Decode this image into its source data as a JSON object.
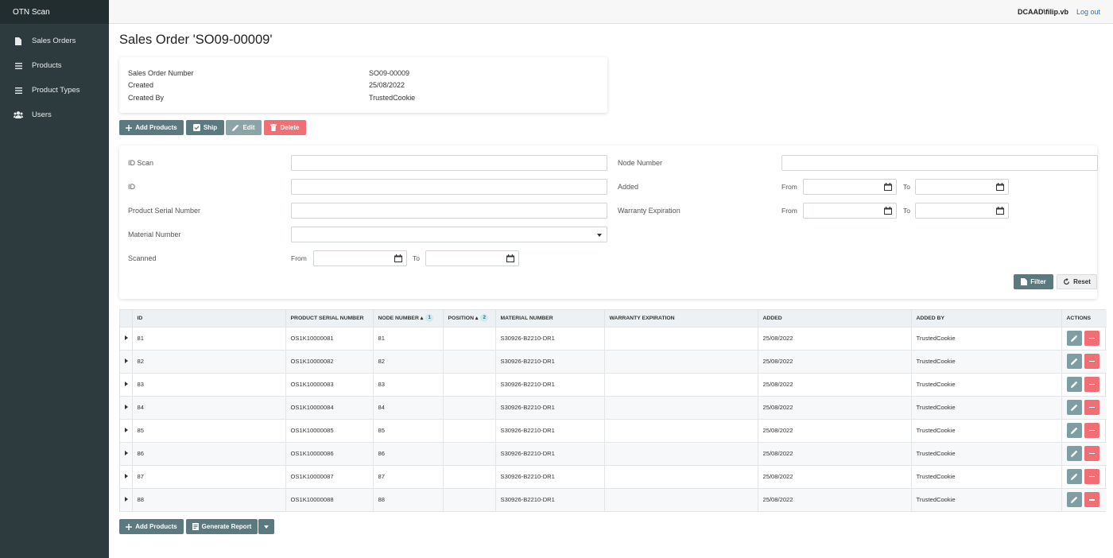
{
  "app": {
    "brand": "OTN Scan"
  },
  "sidebar": {
    "items": [
      {
        "label": "Sales Orders",
        "icon": "document-icon"
      },
      {
        "label": "Products",
        "icon": "list-icon"
      },
      {
        "label": "Product Types",
        "icon": "list-icon"
      },
      {
        "label": "Users",
        "icon": "users-icon"
      }
    ]
  },
  "header": {
    "user": "DCAAD\\filip.vb",
    "logout": "Log out"
  },
  "page": {
    "title": "Sales Order 'SO09-00009'"
  },
  "info": {
    "rows": [
      {
        "label": "Sales Order Number",
        "value": "SO09-00009"
      },
      {
        "label": "Created",
        "value": "25/08/2022"
      },
      {
        "label": "Created By",
        "value": "TrustedCookie"
      }
    ]
  },
  "toolbar": {
    "add_products": "Add Products",
    "ship": "Ship",
    "edit": "Edit",
    "delete": "Delete"
  },
  "filters": {
    "id_scan": "ID Scan",
    "id": "ID",
    "product_serial_number": "Product Serial Number",
    "material_number": "Material Number",
    "scanned": "Scanned",
    "node_number": "Node Number",
    "added": "Added",
    "warranty_expiration": "Warranty Expiration",
    "from": "From",
    "to": "To",
    "filter_button": "Filter",
    "reset_button": "Reset"
  },
  "table": {
    "columns": [
      "ID",
      "PRODUCT SERIAL NUMBER",
      "NODE NUMBER",
      "POSITION",
      "MATERIAL NUMBER",
      "WARRANTY EXPIRATION",
      "ADDED",
      "ADDED BY",
      "ACTIONS"
    ],
    "sort_badges": {
      "node_number": "1",
      "position": "2"
    },
    "rows": [
      {
        "id": "81",
        "serial": "OS1K10000081",
        "node": "81",
        "position": "",
        "material": "S30926-B2210-DR1",
        "warranty": "",
        "added": "25/08/2022",
        "added_by": "TrustedCookie"
      },
      {
        "id": "82",
        "serial": "OS1K10000082",
        "node": "82",
        "position": "",
        "material": "S30926-B2210-DR1",
        "warranty": "",
        "added": "25/08/2022",
        "added_by": "TrustedCookie"
      },
      {
        "id": "83",
        "serial": "OS1K10000083",
        "node": "83",
        "position": "",
        "material": "S30926-B2210-DR1",
        "warranty": "",
        "added": "25/08/2022",
        "added_by": "TrustedCookie"
      },
      {
        "id": "84",
        "serial": "OS1K10000084",
        "node": "84",
        "position": "",
        "material": "S30926-B2210-DR1",
        "warranty": "",
        "added": "25/08/2022",
        "added_by": "TrustedCookie"
      },
      {
        "id": "85",
        "serial": "OS1K10000085",
        "node": "85",
        "position": "",
        "material": "S30926-B2210-DR1",
        "warranty": "",
        "added": "25/08/2022",
        "added_by": "TrustedCookie"
      },
      {
        "id": "86",
        "serial": "OS1K10000086",
        "node": "86",
        "position": "",
        "material": "S30926-B2210-DR1",
        "warranty": "",
        "added": "25/08/2022",
        "added_by": "TrustedCookie"
      },
      {
        "id": "87",
        "serial": "OS1K10000087",
        "node": "87",
        "position": "",
        "material": "S30926-B2210-DR1",
        "warranty": "",
        "added": "25/08/2022",
        "added_by": "TrustedCookie"
      },
      {
        "id": "88",
        "serial": "OS1K10000088",
        "node": "88",
        "position": "",
        "material": "S30926-B2210-DR1",
        "warranty": "",
        "added": "25/08/2022",
        "added_by": "TrustedCookie"
      }
    ]
  },
  "footer": {
    "add_products": "Add Products",
    "generate_report": "Generate Report"
  },
  "colors": {
    "sidebar": "#2e3b3e",
    "primary": "#5a7a80",
    "danger": "#ef6f74"
  }
}
